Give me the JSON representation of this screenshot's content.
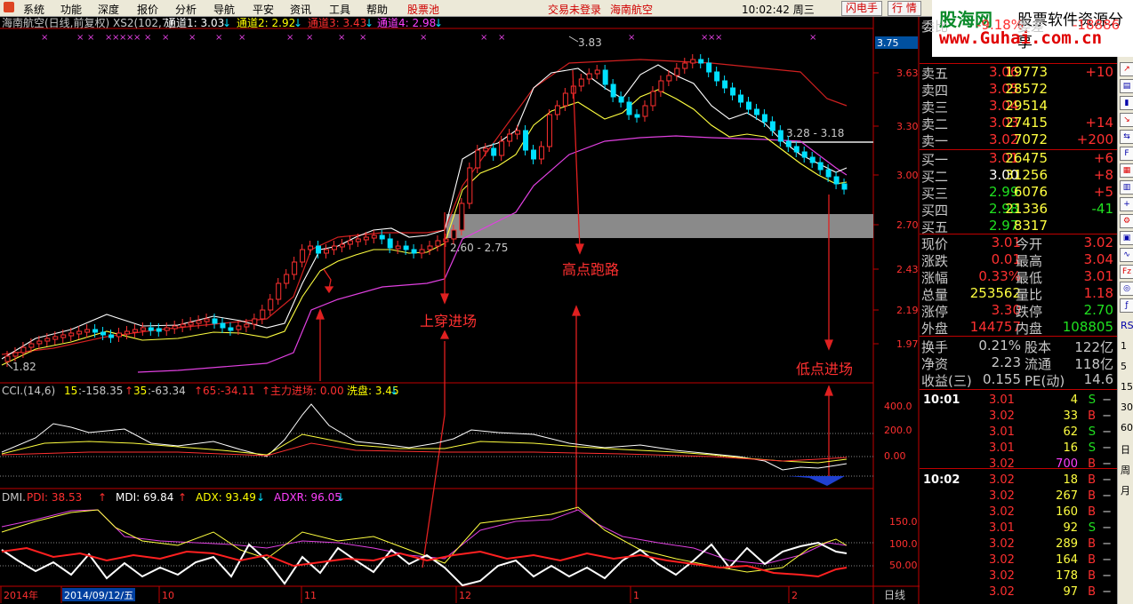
{
  "menu": {
    "items": [
      "系统",
      "功能",
      "深度",
      "报价",
      "分析",
      "导航",
      "平安",
      "资讯",
      "工具",
      "帮助"
    ],
    "highlight": "股票池",
    "status": "交易未登录",
    "stock_link": "海南航空",
    "clock": "10:02:42 周三",
    "btn_flash": "闪电手",
    "btn_quote": "行 情"
  },
  "brand": {
    "cn": "股海网",
    "slogan": "股票软件资源分享",
    "url": "www.Guhai.com.cn"
  },
  "chart": {
    "title": "海南航空(日线,前复权) XS2(102,7)",
    "channels": [
      {
        "label": "通道1: 3.03",
        "color": "#ffffff"
      },
      {
        "label": "通道2: 2.92",
        "color": "#ffff00"
      },
      {
        "label": "通道3: 3.43",
        "color": "#ff3030"
      },
      {
        "label": "通道4: 2.98",
        "color": "#ff40ff"
      }
    ],
    "price_axis": [
      "3.63",
      "3.30",
      "3.00",
      "2.70",
      "2.43",
      "2.19",
      "1.97"
    ],
    "price_box": "3.75",
    "annotations": {
      "high": "3.83",
      "low": "1.82",
      "zone_low": "2.60 - 2.75",
      "zone_high": "3.28 - 3.18",
      "cross_in": "上穿进场",
      "high_exit": "高点跑路",
      "low_in": "低点进场"
    },
    "cci_header": [
      {
        "label": "CCI.(14,6)",
        "color": "#c8c8c8"
      },
      {
        "label": "15",
        "color": "#ffff00"
      },
      {
        "label": ":-158.35",
        "color": "#c8c8c8"
      },
      {
        "label": "35",
        "color": "#ffff00"
      },
      {
        "label": ":-63.34",
        "color": "#c8c8c8"
      },
      {
        "label": "65",
        "color": "#ff3030"
      },
      {
        "label": ":-34.11",
        "color": "#ff3030"
      },
      {
        "label": "主力进场: 0.00",
        "color": "#ff3030"
      },
      {
        "label": "洗盘: 3.45",
        "color": "#ffff00"
      }
    ],
    "cci_axis": [
      "400.0",
      "200.0",
      "0.00"
    ],
    "dmi_header": [
      {
        "label": "DMI.",
        "color": "#c8c8c8"
      },
      {
        "label": "PDI: 38.53",
        "color": "#ff3030"
      },
      {
        "label": "MDI: 69.84",
        "color": "#ffffff"
      },
      {
        "label": "ADX: 93.49",
        "color": "#ffff00"
      },
      {
        "label": "ADXR: 96.05",
        "color": "#ff40ff"
      }
    ],
    "dmi_axis": [
      "150.0",
      "100.0",
      "50.00"
    ],
    "dates": [
      "2014年",
      "2014/09/12/五",
      "10",
      "11",
      "12",
      "1",
      "2"
    ],
    "period": "日线"
  },
  "quote": {
    "header": {
      "l1": "委比",
      "v1": "-9.18%",
      "l2": "委差",
      "v2": "-18886"
    },
    "asks": [
      {
        "label": "卖五",
        "price": "3.06",
        "vol": "19773",
        "chg": "+10"
      },
      {
        "label": "卖四",
        "price": "3.05",
        "vol": "28572",
        "chg": ""
      },
      {
        "label": "卖三",
        "price": "3.04",
        "vol": "29514",
        "chg": ""
      },
      {
        "label": "卖二",
        "price": "3.03",
        "vol": "27415",
        "chg": "+14"
      },
      {
        "label": "卖一",
        "price": "3.02",
        "vol": "7072",
        "chg": "+200"
      }
    ],
    "bids": [
      {
        "label": "买一",
        "price": "3.01",
        "vol": "26475",
        "chg": "+6"
      },
      {
        "label": "买二",
        "price": "3.00",
        "vol": "31256",
        "chg": "+8"
      },
      {
        "label": "买三",
        "price": "2.99",
        "vol": "6076",
        "chg": "+5"
      },
      {
        "label": "买四",
        "price": "2.98",
        "vol": "21336",
        "chg": "-41"
      },
      {
        "label": "买五",
        "price": "2.97",
        "vol": "8317",
        "chg": ""
      }
    ],
    "stats": [
      {
        "l1": "现价",
        "v1": "3.01",
        "l2": "今开",
        "v2": "3.02"
      },
      {
        "l1": "涨跌",
        "v1": "0.01",
        "l2": "最高",
        "v2": "3.04"
      },
      {
        "l1": "涨幅",
        "v1": "0.33%",
        "l2": "最低",
        "v2": "3.01"
      },
      {
        "l1": "总量",
        "v1": "253562",
        "l2": "量比",
        "v2": "1.18"
      },
      {
        "l1": "涨停",
        "v1": "3.30",
        "l2": "跌停",
        "v2": "2.70"
      },
      {
        "l1": "外盘",
        "v1": "144757",
        "l2": "内盘",
        "v2": "108805"
      }
    ],
    "stats2": [
      {
        "l1": "换手",
        "v1": "0.21%",
        "l2": "股本",
        "v2": "122亿"
      },
      {
        "l1": "净资",
        "v1": "2.23",
        "l2": "流通",
        "v2": "118亿"
      },
      {
        "l1": "收益(三)",
        "v1": "0.155",
        "l2": "PE(动)",
        "v2": "14.6"
      }
    ],
    "ticks": [
      {
        "time": "10:01",
        "price": "3.01",
        "vol": "4",
        "side": "S"
      },
      {
        "time": "",
        "price": "3.02",
        "vol": "33",
        "side": "B"
      },
      {
        "time": "",
        "price": "3.01",
        "vol": "62",
        "side": "S"
      },
      {
        "time": "",
        "price": "3.01",
        "vol": "16",
        "side": "S"
      },
      {
        "time": "",
        "price": "3.02",
        "vol": "700",
        "side": "B"
      },
      {
        "time": "10:02",
        "price": "3.02",
        "vol": "18",
        "side": "B"
      },
      {
        "time": "",
        "price": "3.02",
        "vol": "267",
        "side": "B"
      },
      {
        "time": "",
        "price": "3.02",
        "vol": "160",
        "side": "B"
      },
      {
        "time": "",
        "price": "3.01",
        "vol": "92",
        "side": "S"
      },
      {
        "time": "",
        "price": "3.02",
        "vol": "289",
        "side": "B"
      },
      {
        "time": "",
        "price": "3.02",
        "vol": "164",
        "side": "B"
      },
      {
        "time": "",
        "price": "3.02",
        "vol": "178",
        "side": "B"
      },
      {
        "time": "",
        "price": "3.02",
        "vol": "97",
        "side": "B"
      }
    ]
  },
  "sidebar": {
    "labels": [
      "RSI",
      "1",
      "5",
      "15",
      "30",
      "60",
      "日",
      "周",
      "月"
    ]
  }
}
